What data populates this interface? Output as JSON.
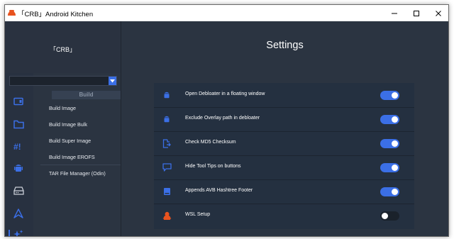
{
  "window": {
    "title": "「CRB」Android Kitchen",
    "controls": {
      "minimize": "minimize-icon",
      "maximize": "maximize-icon",
      "close": "close-icon"
    }
  },
  "sidebar": {
    "brand": "「CRB」",
    "dropdown": {
      "value": ""
    },
    "icons": [
      "rom-folder-icon",
      "folder-icon",
      "hashbang-icon",
      "android-icon",
      "drive-icon",
      "arch-icon",
      "sparkle-icon"
    ],
    "section_header": "Build",
    "items": [
      {
        "label": "Build Image"
      },
      {
        "label": "Build Image Bulk"
      },
      {
        "label": "Build Super Image"
      },
      {
        "label": "Build Image EROFS"
      },
      {
        "label": "TAR File Manager (Odin)"
      }
    ]
  },
  "main": {
    "title": "Settings",
    "settings": [
      {
        "label": "Open Debloater in a floating window",
        "icon": "android-icon",
        "enabled": true
      },
      {
        "label": "Exclude Overlay path in debloater",
        "icon": "android-icon",
        "enabled": true
      },
      {
        "label": "Check MD5 Checksum",
        "icon": "file-export-icon",
        "enabled": true
      },
      {
        "label": "Hide Tool Tips on buttons",
        "icon": "tooltip-icon",
        "enabled": true
      },
      {
        "label": "Appends AVB Hashtree Footer",
        "icon": "sd-card-icon",
        "enabled": true
      },
      {
        "label": "WSL Setup",
        "icon": "linux-penguin-icon",
        "enabled": false
      }
    ]
  },
  "colors": {
    "accent": "#3b6fe6",
    "penguin": "#e8531f",
    "background": "#2b3441",
    "panel": "#243040"
  }
}
